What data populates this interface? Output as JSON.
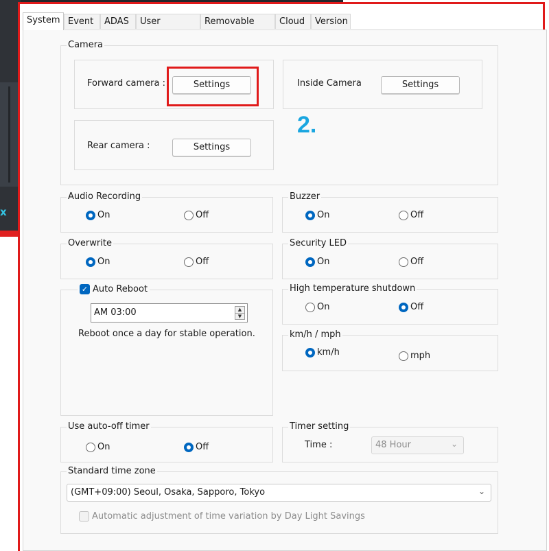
{
  "tabs": [
    "System",
    "Event",
    "ADAS",
    "User Settings",
    "Removable Disk",
    "Cloud",
    "Version"
  ],
  "camera": {
    "group_title": "Camera",
    "forward_label": "Forward camera :",
    "inside_label": "Inside Camera",
    "rear_label": "Rear camera :",
    "settings_label": "Settings",
    "step_marker": "2."
  },
  "audio_recording": {
    "title": "Audio Recording",
    "on": "On",
    "off": "Off",
    "selected": "On"
  },
  "buzzer": {
    "title": "Buzzer",
    "on": "On",
    "off": "Off",
    "selected": "On"
  },
  "overwrite": {
    "title": "Overwrite",
    "on": "On",
    "off": "Off",
    "selected": "On"
  },
  "security_led": {
    "title": "Security LED",
    "on": "On",
    "off": "Off",
    "selected": "On"
  },
  "auto_reboot": {
    "checkbox_label": "Auto Reboot",
    "checked": true,
    "time_value": "AM  03:00",
    "description": "Reboot once a day for stable operation."
  },
  "high_temp": {
    "title": "High temperature shutdown",
    "on": "On",
    "off": "Off",
    "selected": "Off"
  },
  "speed_unit": {
    "title": "km/h / mph",
    "kmh": "km/h",
    "mph": "mph",
    "selected": "km/h"
  },
  "auto_off_timer": {
    "title": "Use auto-off timer",
    "on": "On",
    "off": "Off",
    "selected": "Off"
  },
  "timer_setting": {
    "title": "Timer setting",
    "time_label": "Time :",
    "value": "48 Hour"
  },
  "time_zone": {
    "title": "Standard time zone",
    "value": "(GMT+09:00) Seoul, Osaka, Sapporo, Tokyo",
    "dst_label": "Automatic adjustment of time variation by Day Light Savings"
  },
  "side": {
    "glyph": "x"
  },
  "colors": {
    "highlight": "#e01a1a",
    "accent": "#0067c0",
    "step_marker": "#1aa6e0"
  }
}
